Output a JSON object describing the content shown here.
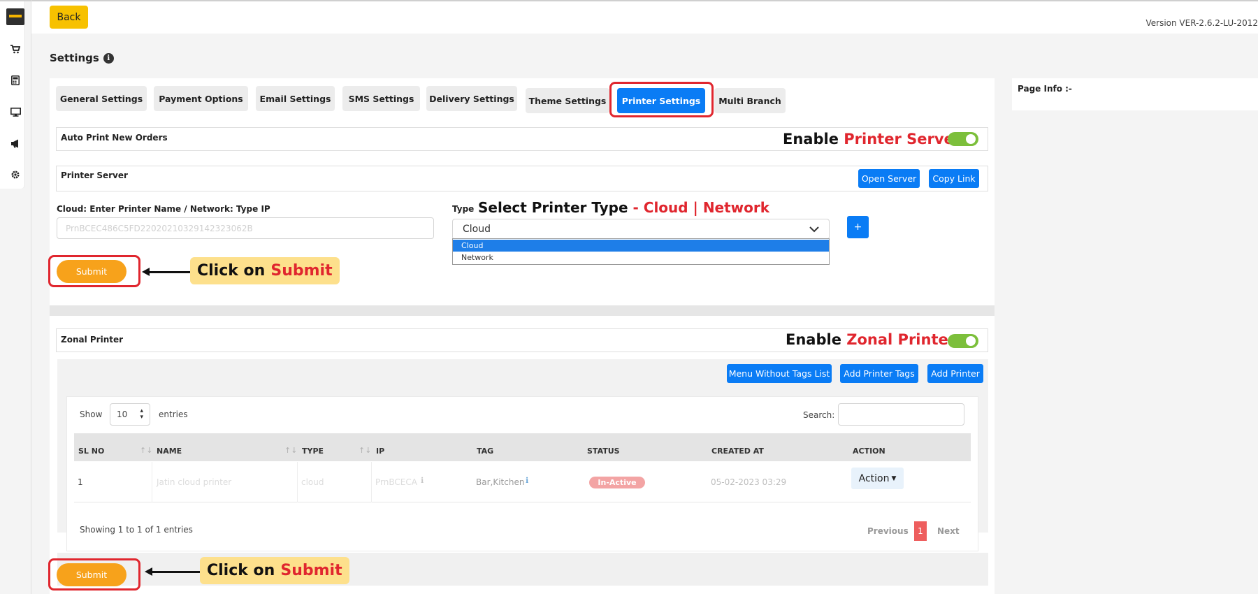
{
  "header": {
    "back_label": "Back",
    "version": "Version VER-2.6.2-LU-2012"
  },
  "page": {
    "title": "Settings",
    "info_label": "Page Info :-"
  },
  "sidebar": {
    "icons": [
      "cart-icon",
      "calculator-icon",
      "monitor-icon",
      "megaphone-icon",
      "gear-icon"
    ]
  },
  "tabs": [
    {
      "label": "General Settings"
    },
    {
      "label": "Payment Options"
    },
    {
      "label": "Email Settings"
    },
    {
      "label": "SMS Settings"
    },
    {
      "label": "Delivery Settings"
    },
    {
      "label": "Theme Settings"
    },
    {
      "label": "Printer Settings"
    },
    {
      "label": "Multi Branch"
    }
  ],
  "auto_print": {
    "label": "Auto Print New Orders",
    "annot_prefix": "Enable",
    "annot_highlight": "Printer Server"
  },
  "printer_server": {
    "label": "Printer Server",
    "open_label": "Open Server",
    "copy_label": "Copy Link"
  },
  "printer_form": {
    "name_label": "Cloud: Enter Printer Name / Network: Type IP",
    "name_value": "PrnBCEC486C5FD22020210329142323062B",
    "type_label": "Type",
    "type_annot": "Select Printer Type",
    "type_annot_options": "- Cloud | Network",
    "type_value": "Cloud",
    "type_options": [
      "Cloud",
      "Network"
    ],
    "plus_label": "+",
    "submit_label": "Submit"
  },
  "callout": {
    "prefix": "Click on",
    "highlight": "Submit"
  },
  "zonal": {
    "label": "Zonal Printer",
    "annot_prefix": "Enable",
    "annot_highlight": "Zonal Printer",
    "menu_without_tags": "Menu Without Tags List",
    "add_tags": "Add Printer Tags",
    "add_printer": "Add Printer"
  },
  "table": {
    "show_label": "Show",
    "entries_value": "10",
    "entries_label": "entries",
    "search_label": "Search:",
    "columns": [
      "SL NO",
      "NAME",
      "TYPE",
      "IP",
      "TAG",
      "STATUS",
      "CREATED AT",
      "ACTION"
    ],
    "rows": [
      {
        "sl": "1",
        "name": "Jatin cloud printer",
        "type": "cloud",
        "ip": "PrnBCECA",
        "tag": "Bar,Kitchen",
        "status": "In-Active",
        "created": "05-02-2023 03:29",
        "action": "Action"
      }
    ],
    "showing": "Showing 1 to 1 of 1 entries",
    "prev": "Previous",
    "page": "1",
    "next": "Next"
  },
  "bottom": {
    "submit_label": "Submit"
  },
  "colors": {
    "accent": "#0a7cf5",
    "highlight": "#e0262e",
    "submit": "#f7a21b",
    "toggle_on": "#7cbf3b"
  }
}
